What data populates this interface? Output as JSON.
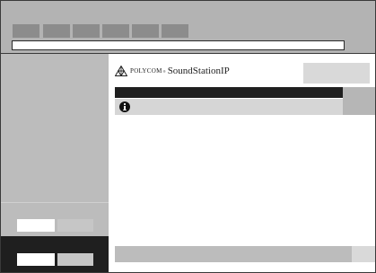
{
  "header": {
    "brand": "POLYCOM",
    "registered_mark": "®",
    "product": "SoundStationIP",
    "logo_icon": "polycom-triangle-logo-icon"
  },
  "info": {
    "icon": "info-icon"
  }
}
